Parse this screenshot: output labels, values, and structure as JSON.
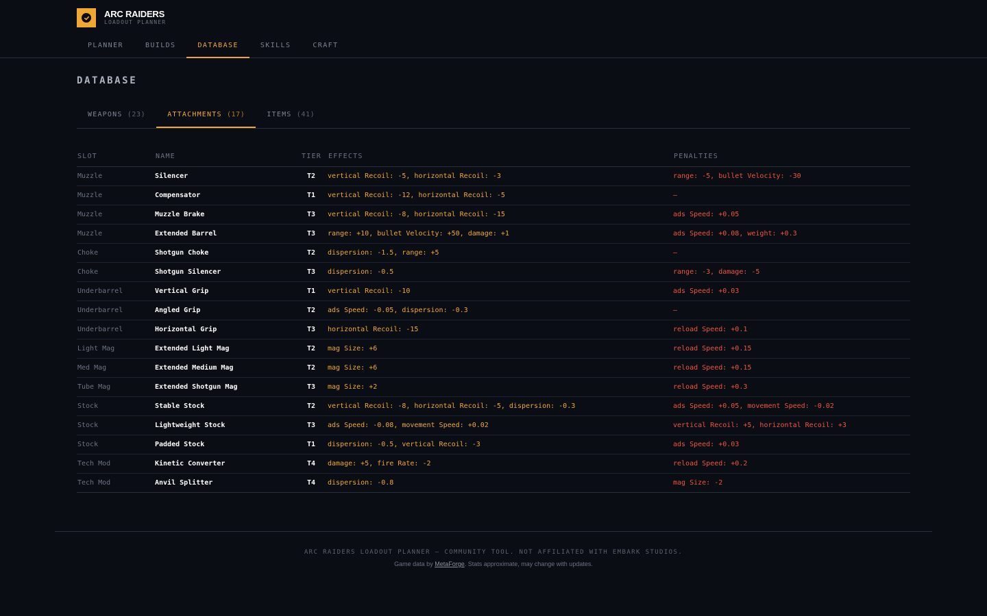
{
  "brand": {
    "title": "ARC RAIDERS",
    "subtitle": "LOADOUT PLANNER",
    "accent_color": "#f0a830"
  },
  "nav": {
    "items": [
      {
        "label": "PLANNER"
      },
      {
        "label": "BUILDS"
      },
      {
        "label": "DATABASE"
      },
      {
        "label": "SKILLS"
      },
      {
        "label": "CRAFT"
      }
    ],
    "active": "DATABASE"
  },
  "page": {
    "title": "DATABASE"
  },
  "subtabs": [
    {
      "label": "WEAPONS",
      "count": "(23)"
    },
    {
      "label": "ATTACHMENTS",
      "count": "(17)"
    },
    {
      "label": "ITEMS",
      "count": "(41)"
    }
  ],
  "active_subtab": "ATTACHMENTS",
  "table": {
    "headers": {
      "slot": "SLOT",
      "name": "NAME",
      "tier": "TIER",
      "effects": "EFFECTS",
      "penalties": "PENALTIES"
    },
    "rows": [
      {
        "slot": "Muzzle",
        "name": "Silencer",
        "tier": "T2",
        "effects": "vertical Recoil: -5, horizontal Recoil: -3",
        "penalties": "range: -5, bullet Velocity: -30"
      },
      {
        "slot": "Muzzle",
        "name": "Compensator",
        "tier": "T1",
        "effects": "vertical Recoil: -12, horizontal Recoil: -5",
        "penalties": "—"
      },
      {
        "slot": "Muzzle",
        "name": "Muzzle Brake",
        "tier": "T3",
        "effects": "vertical Recoil: -8, horizontal Recoil: -15",
        "penalties": "ads Speed: +0.05"
      },
      {
        "slot": "Muzzle",
        "name": "Extended Barrel",
        "tier": "T3",
        "effects": "range: +10, bullet Velocity: +50, damage: +1",
        "penalties": "ads Speed: +0.08, weight: +0.3"
      },
      {
        "slot": "Choke",
        "name": "Shotgun Choke",
        "tier": "T2",
        "effects": "dispersion: -1.5, range: +5",
        "penalties": "—"
      },
      {
        "slot": "Choke",
        "name": "Shotgun Silencer",
        "tier": "T3",
        "effects": "dispersion: -0.5",
        "penalties": "range: -3, damage: -5"
      },
      {
        "slot": "Underbarrel",
        "name": "Vertical Grip",
        "tier": "T1",
        "effects": "vertical Recoil: -10",
        "penalties": "ads Speed: +0.03"
      },
      {
        "slot": "Underbarrel",
        "name": "Angled Grip",
        "tier": "T2",
        "effects": "ads Speed: -0.05, dispersion: -0.3",
        "penalties": "—"
      },
      {
        "slot": "Underbarrel",
        "name": "Horizontal Grip",
        "tier": "T3",
        "effects": "horizontal Recoil: -15",
        "penalties": "reload Speed: +0.1"
      },
      {
        "slot": "Light Mag",
        "name": "Extended Light Mag",
        "tier": "T2",
        "effects": "mag Size: +6",
        "penalties": "reload Speed: +0.15"
      },
      {
        "slot": "Med Mag",
        "name": "Extended Medium Mag",
        "tier": "T2",
        "effects": "mag Size: +6",
        "penalties": "reload Speed: +0.15"
      },
      {
        "slot": "Tube Mag",
        "name": "Extended Shotgun Mag",
        "tier": "T3",
        "effects": "mag Size: +2",
        "penalties": "reload Speed: +0.3"
      },
      {
        "slot": "Stock",
        "name": "Stable Stock",
        "tier": "T2",
        "effects": "vertical Recoil: -8, horizontal Recoil: -5, dispersion: -0.3",
        "penalties": "ads Speed: +0.05, movement Speed: -0.02"
      },
      {
        "slot": "Stock",
        "name": "Lightweight Stock",
        "tier": "T3",
        "effects": "ads Speed: -0.08, movement Speed: +0.02",
        "penalties": "vertical Recoil: +5, horizontal Recoil: +3"
      },
      {
        "slot": "Stock",
        "name": "Padded Stock",
        "tier": "T1",
        "effects": "dispersion: -0.5, vertical Recoil: -3",
        "penalties": "ads Speed: +0.03"
      },
      {
        "slot": "Tech Mod",
        "name": "Kinetic Converter",
        "tier": "T4",
        "effects": "damage: +5, fire Rate: -2",
        "penalties": "reload Speed: +0.2"
      },
      {
        "slot": "Tech Mod",
        "name": "Anvil Splitter",
        "tier": "T4",
        "effects": "dispersion: -0.8",
        "penalties": "mag Size: -2"
      }
    ]
  },
  "footer": {
    "line1": "ARC RAIDERS LOADOUT PLANNER — COMMUNITY TOOL. NOT AFFILIATED WITH EMBARK STUDIOS.",
    "line2_prefix": "Game data by",
    "line2_link": "MetaForge",
    "line2_suffix": ". Stats approximate, may change with updates."
  }
}
